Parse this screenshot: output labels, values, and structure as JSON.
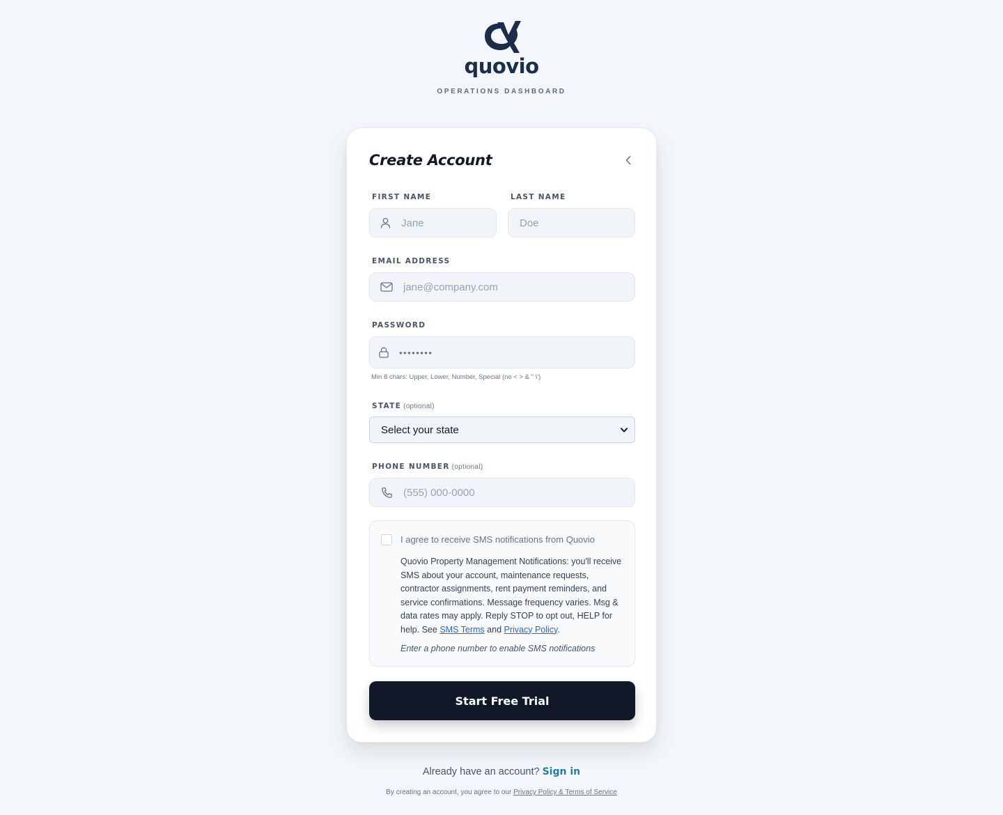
{
  "brand": {
    "name": "quovio",
    "subtitle": "OPERATIONS DASHBOARD"
  },
  "form": {
    "title": "Create Account",
    "first_name": {
      "label": "FIRST NAME",
      "placeholder": "Jane",
      "icon": "user-icon"
    },
    "last_name": {
      "label": "LAST NAME",
      "placeholder": "Doe"
    },
    "email": {
      "label": "EMAIL ADDRESS",
      "placeholder": "jane@company.com",
      "icon": "mail-icon"
    },
    "password": {
      "label": "PASSWORD",
      "value": "••••••••",
      "icon": "lock-icon",
      "hint": "Min 8 chars: Upper, Lower, Number, Special (no < > & \" \\')"
    },
    "state": {
      "label": "STATE",
      "optional": "(optional)",
      "selected": "Select your state"
    },
    "phone": {
      "label": "PHONE NUMBER",
      "optional": "(optional)",
      "placeholder": "(555) 000-0000",
      "icon": "phone-icon"
    },
    "sms": {
      "checkbox_label": "I agree to receive SMS notifications from Quovio",
      "checked": false,
      "body_text": "Quovio Property Management Notifications: you'll receive SMS about your account, maintenance requests, contractor assignments, rent payment reminders, and service confirmations. Message frequency varies. Msg & data rates may apply. Reply STOP to opt out, HELP for help. See",
      "sms_terms_link": "SMS Terms",
      "and_text": "and",
      "privacy_link": "Privacy Policy",
      "period": ".",
      "note": "Enter a phone number to enable SMS notifications"
    },
    "submit_label": "Start Free Trial"
  },
  "footer": {
    "already_text": "Already have an account?",
    "sign_in": "Sign in",
    "legal_text": "By creating an account, you agree to our",
    "legal_link": "Privacy Policy & Terms of Service"
  },
  "colors": {
    "background": "#f3f6fa",
    "brand_navy": "#1b2d4a",
    "button": "#111827",
    "link": "#2563eb",
    "sign_in": "#1f7ea1"
  }
}
